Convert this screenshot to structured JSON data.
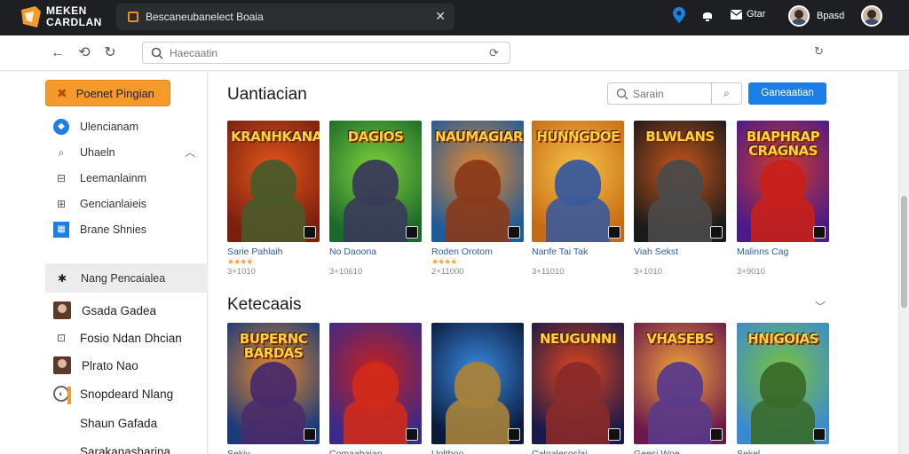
{
  "app": {
    "logo_text": "MEKEN\nCARDLAN",
    "brand_color": "#f59a2a",
    "accent_color": "#1d7fe6"
  },
  "tab": {
    "title": "Bescaneubanelect Boaia"
  },
  "topbar": {
    "mail_label": "Gtar",
    "user_name": "Bpasd"
  },
  "address": {
    "placeholder": "Haecaatin"
  },
  "sidebar": {
    "primary_button": "Poenet Pingian",
    "items": [
      {
        "label": "Ulencianam",
        "icon": "compass-icon"
      },
      {
        "label": "Uhaeln",
        "icon": "tag-icon"
      },
      {
        "label": "Leemanlainm",
        "icon": "library-icon"
      },
      {
        "label": "Gencianlaieis",
        "icon": "grid-icon"
      },
      {
        "label": "Brane Shnies",
        "icon": "app-icon"
      }
    ],
    "group_header": "Nang Pencaialea",
    "friends": [
      {
        "name": "Gsada Gadea"
      },
      {
        "name": "Fosio Ndan Dhcian"
      },
      {
        "name": "Plrato Nao"
      },
      {
        "name": "Snopdeard Nlang"
      },
      {
        "name": "Shaun Gafada"
      },
      {
        "name": "Sarakanasharina"
      }
    ]
  },
  "main": {
    "section1_title": "Uantiacian",
    "search_placeholder": "Sarain",
    "blue_button": "Ganeaatian",
    "section2_title": "Ketecaais",
    "row1": [
      {
        "cover_text": "KRANHKANAIN",
        "name": "Sarie Pahlaih",
        "meta": "3+1010",
        "stars": "★★★★",
        "c1": "#7a1f0e",
        "c2": "#e2561a",
        "hero": "#4a5a2a"
      },
      {
        "cover_text": "DAGIOS",
        "name": "No Daoona",
        "meta": "3+10610",
        "stars": "",
        "c1": "#1a6a2a",
        "c2": "#7fd23a",
        "hero": "#3a3a5a"
      },
      {
        "cover_text": "NAUMAGIAR",
        "name": "Roden Orotom",
        "meta": "2+11000",
        "stars": "★★★★",
        "c1": "#1f5a9a",
        "c2": "#e88a2a",
        "hero": "#8a3a1a"
      },
      {
        "cover_text": "HUNNGDOE",
        "name": "Nanfe Tai Tak",
        "meta": "3+11010",
        "stars": "",
        "c1": "#c86a12",
        "c2": "#f5c24a",
        "hero": "#3a5a9a"
      },
      {
        "cover_text": "BLWLANS",
        "name": "Viah Sekst",
        "meta": "3+1010",
        "stars": "",
        "c1": "#1a1a1a",
        "c2": "#c8561a",
        "hero": "#4a4a4a"
      },
      {
        "cover_text": "BIAPHRAP CRAGNAS",
        "name": "Malinns Cag",
        "meta": "3+9010",
        "stars": "",
        "c1": "#4a1a8a",
        "c2": "#d23a2a",
        "hero": "#c8201a"
      }
    ],
    "row2": [
      {
        "cover_text": "BUPERNC BARDAS",
        "name": "Sekiy",
        "c1": "#1a3a7a",
        "c2": "#e88a2a",
        "hero": "#4a2a6a"
      },
      {
        "cover_text": "",
        "name": "Comaabaian",
        "c1": "#3a2a8a",
        "c2": "#c8201a",
        "hero": "#d22a1a"
      },
      {
        "cover_text": "",
        "name": "Uolthoo",
        "c1": "#0a1a3a",
        "c2": "#3a8ae2",
        "hero": "#a8823a"
      },
      {
        "cover_text": "NEUGUNNI",
        "name": "Calnalesoslai",
        "c1": "#1a1a4a",
        "c2": "#e2461a",
        "hero": "#8a2a2a"
      },
      {
        "cover_text": "VHASEBS",
        "name": "Geesi Woe",
        "c1": "#6a1a4a",
        "c2": "#f5a23a",
        "hero": "#5a3a8a"
      },
      {
        "cover_text": "HNIGOIAS",
        "name": "Sekel",
        "c1": "#3a8ad2",
        "c2": "#7ac23a",
        "hero": "#3a6a2a"
      }
    ]
  }
}
